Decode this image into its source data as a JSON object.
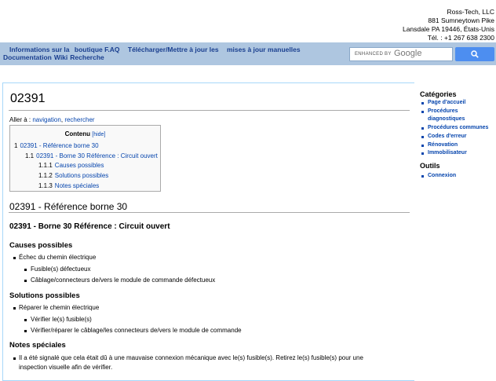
{
  "company": {
    "name": "Ross-Tech, LLC",
    "street": "881 Sumneytown Pike",
    "city": "Lansdale PA 19446, États-Unis",
    "phone": "Tél. : +1 267 638 2300"
  },
  "nav": {
    "line1": [
      "Informations sur la",
      "boutique F.AQ",
      "Télécharger/Mettre à jour les",
      "mises à jour manuelles"
    ],
    "line2": [
      "Documentation",
      "Wiki",
      "Recherche"
    ]
  },
  "search": {
    "enhanced": "ENHANCED BY",
    "google": "Google",
    "button_icon": "search-icon"
  },
  "page": {
    "title": "02391",
    "goto_label": "Aller à :",
    "goto_nav": "navigation",
    "goto_sep": ",",
    "goto_search": "rechercher"
  },
  "toc": {
    "title": "Contenu",
    "hide": "[hide]",
    "entries": [
      {
        "num": "1",
        "text": "02391 - Référence borne 30"
      },
      {
        "num": "1.1",
        "text": "02391 - Borne 30 Référence : Circuit ouvert"
      },
      {
        "num": "1.1.1",
        "text": "Causes possibles"
      },
      {
        "num": "1.1.2",
        "text": "Solutions possibles"
      },
      {
        "num": "1.1.3",
        "text": "Notes spéciales"
      }
    ]
  },
  "article": {
    "h2": "02391 - Référence borne 30",
    "h3": "02391 - Borne 30 Référence : Circuit ouvert",
    "causes_title": "Causes possibles",
    "causes": {
      "main": "Échec du chemin électrique",
      "subs": [
        "Fusible(s) défectueux",
        "Câblage/connecteurs de/vers le module de commande défectueux"
      ]
    },
    "solutions_title": "Solutions possibles",
    "solutions": {
      "main": "Réparer le chemin électrique",
      "subs": [
        "Vérifier le(s) fusible(s)",
        "Vérifier/réparer le câblage/les connecteurs de/vers le module de commande"
      ]
    },
    "notes_title": "Notes spéciales",
    "notes": {
      "line1": "Il a été signalé que cela était dû à une mauvaise connexion mécanique avec le(s) fusible(s). Retirez le(s) fusible(s) pour une",
      "line2": "inspection visuelle afin de vérifier."
    }
  },
  "sidebar": {
    "categories_title": "Catégories",
    "categories": [
      "Page d'accueil",
      "Procédures diagnostiques",
      "Procédures communes",
      "Codes d'erreur",
      "Rénovation",
      "Immobilisateur"
    ],
    "tools_title": "Outils",
    "tools": [
      "Connexion"
    ]
  }
}
